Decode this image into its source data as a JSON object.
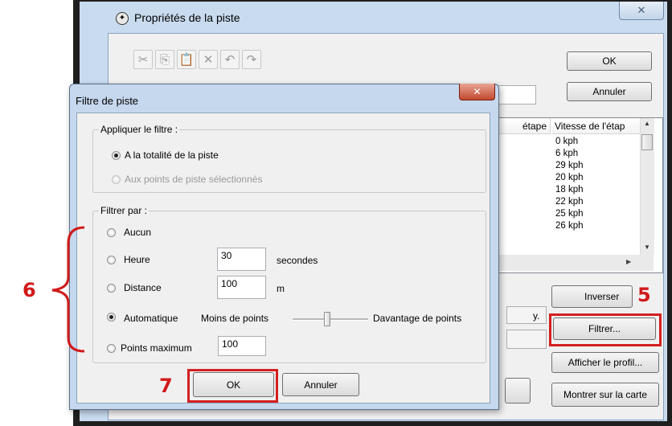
{
  "parent_window": {
    "title": "Propriétés de la piste",
    "close_icon": "x-icon",
    "toolbar_icons": [
      "scissors-icon",
      "copy-icon",
      "paste-icon",
      "delete-icon",
      "undo-icon",
      "redo-icon"
    ],
    "ok_label": "OK",
    "cancel_label": "Annuler",
    "columns": [
      "étape",
      "Vitesse de l'étap"
    ],
    "speeds": [
      "0 kph",
      "6 kph",
      "29 kph",
      "20 kph",
      "18 kph",
      "22 kph",
      "25 kph",
      "26 kph"
    ],
    "hidden_text": "y.",
    "invert_label": "Inverser",
    "filter_label": "Filtrer...",
    "profile_label": "Afficher le profil...",
    "show_on_map_label": "Montrer sur la carte"
  },
  "dialog": {
    "title": "Filtre de piste",
    "apply_group_label": "Appliquer le filtre :",
    "apply_options": [
      {
        "label": "A la totalité de la piste",
        "selected": true,
        "enabled": true
      },
      {
        "label": "Aux points de piste sélectionnés",
        "selected": false,
        "enabled": false
      }
    ],
    "filter_group_label": "Filtrer par :",
    "filter_options": {
      "none": {
        "label": "Aucun"
      },
      "time": {
        "label": "Heure",
        "value": "30",
        "unit": "secondes"
      },
      "distance": {
        "label": "Distance",
        "value": "100",
        "unit": "m"
      },
      "auto": {
        "label": "Automatique",
        "selected": true,
        "less": "Moins de points",
        "more": "Davantage de points",
        "slider_level": 0.45
      },
      "max": {
        "label": "Points maximum",
        "value": "100"
      }
    },
    "ok_label": "OK",
    "cancel_label": "Annuler"
  },
  "annotations": {
    "six": "6",
    "five": "5",
    "seven": "7",
    "color": "#d11a1a"
  }
}
